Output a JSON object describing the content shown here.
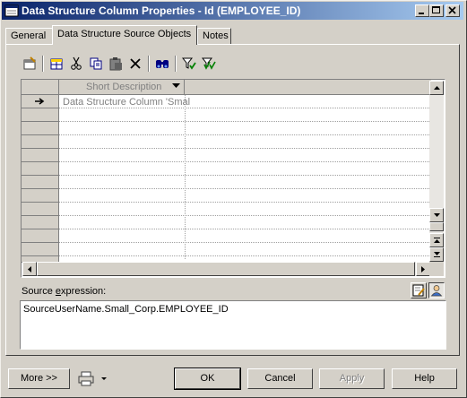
{
  "window": {
    "title": "Data Structure Column Properties - Id (EMPLOYEE_ID)"
  },
  "tabs": [
    {
      "label": "General"
    },
    {
      "label": "Data Structure Source Objects"
    },
    {
      "label": "Notes"
    }
  ],
  "toolbar": {
    "icons": [
      "properties-icon",
      "add-objects-icon",
      "cut-icon",
      "copy-icon",
      "paste-icon",
      "delete-icon",
      "find-icon",
      "filter-icon",
      "clear-filter-icon"
    ]
  },
  "grid": {
    "column_header": "Short Description",
    "rows": [
      {
        "current": true,
        "short_description": "Data Structure Column 'Smal"
      }
    ]
  },
  "source": {
    "label_pre": "Source ",
    "label_hotkey": "e",
    "label_post": "xpression:",
    "expression": "SourceUserName.Small_Corp.EMPLOYEE_ID"
  },
  "buttons": {
    "more": "More >>",
    "ok": "OK",
    "cancel": "Cancel",
    "apply": "Apply",
    "help": "Help"
  }
}
